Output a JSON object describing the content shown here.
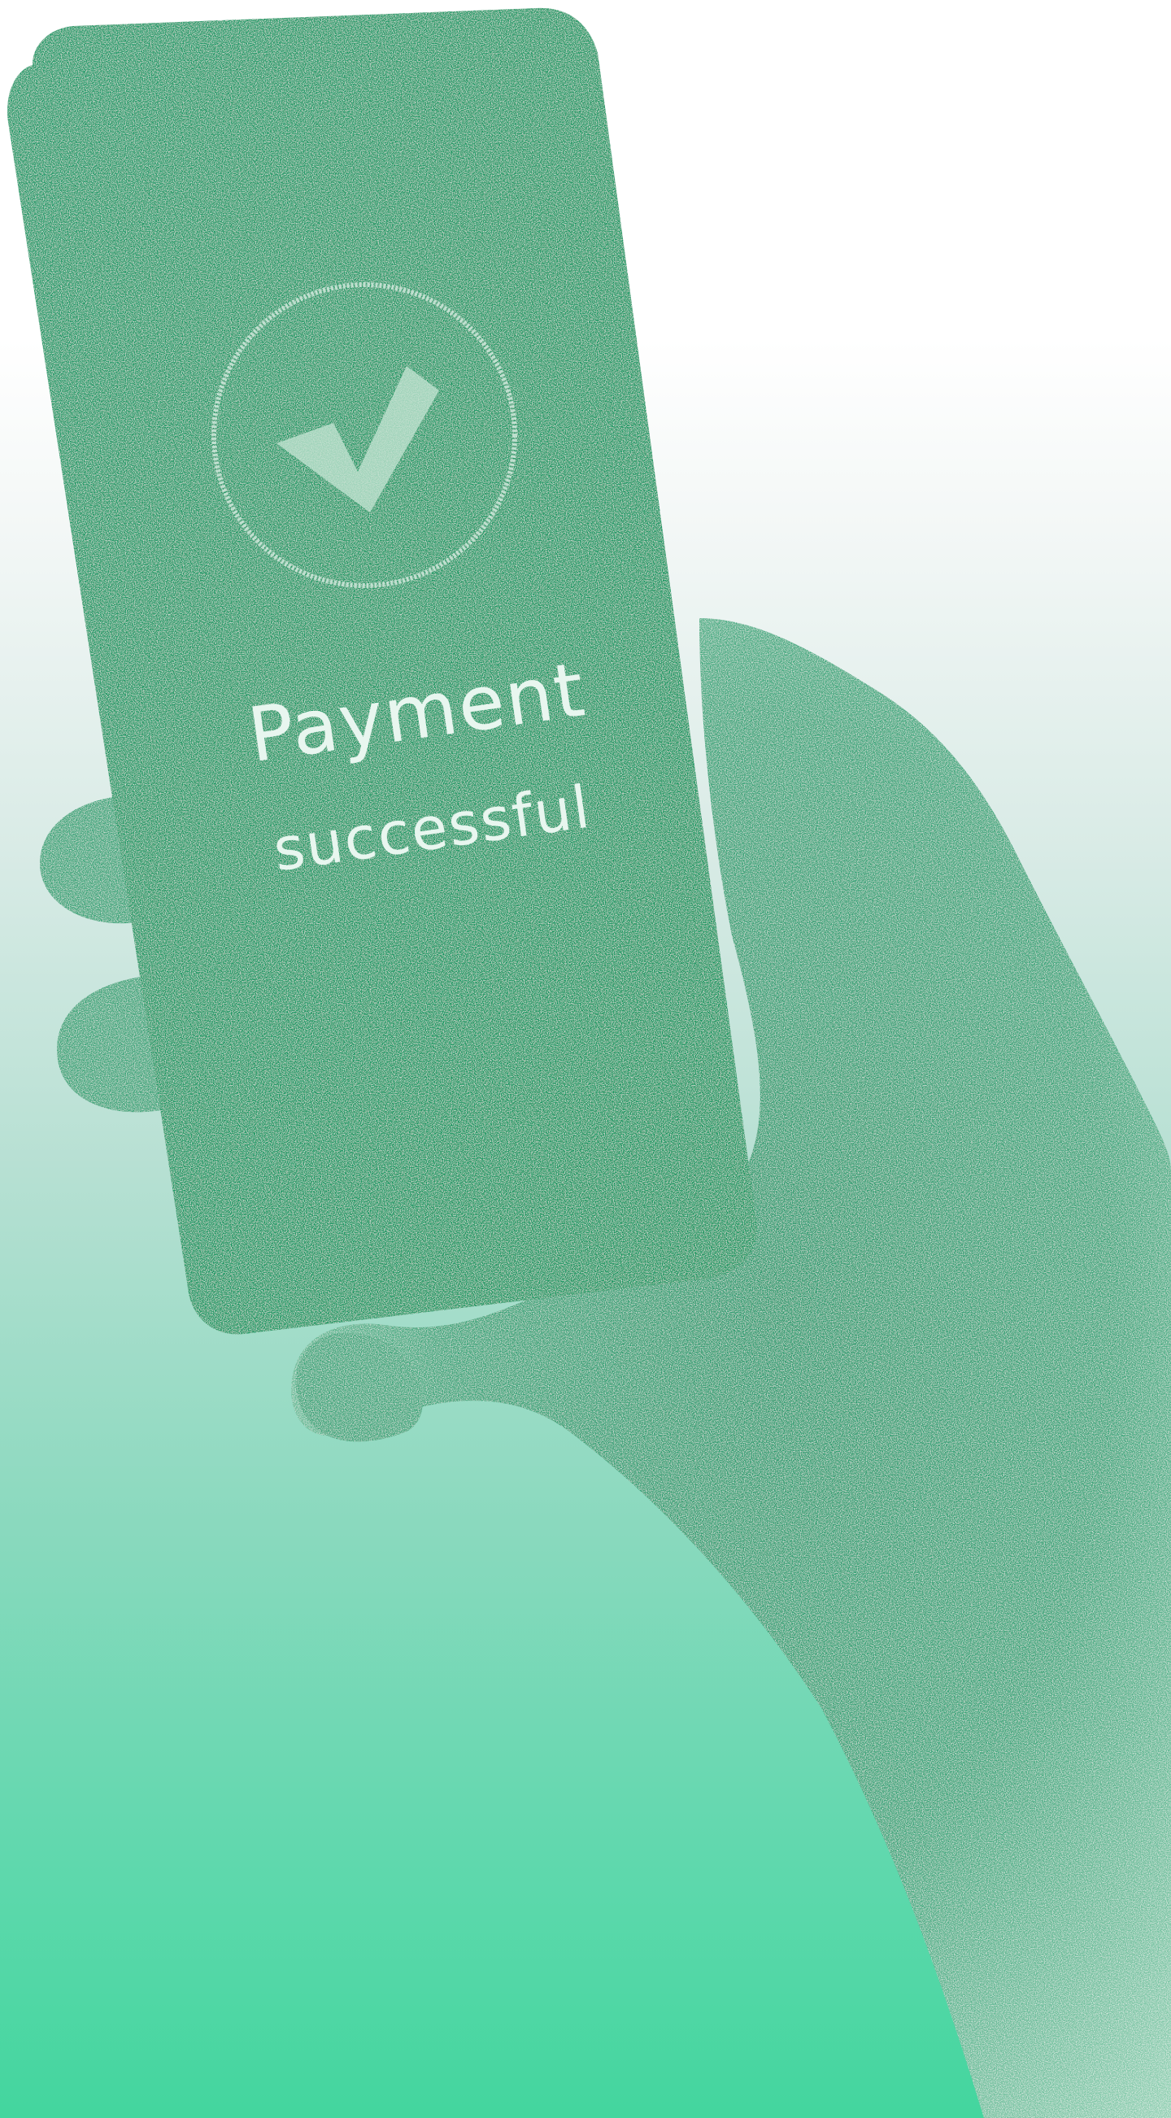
{
  "scene": {
    "background_top_color": "#ffffff",
    "background_bottom_color": "#43d69e",
    "phone_color": "#199a68",
    "hand_color": "#1f8a60",
    "check_color": "#cfe8db"
  },
  "phone_screen": {
    "status_icon": "check-circle-icon",
    "headline": "Payment",
    "subline": "successful"
  }
}
